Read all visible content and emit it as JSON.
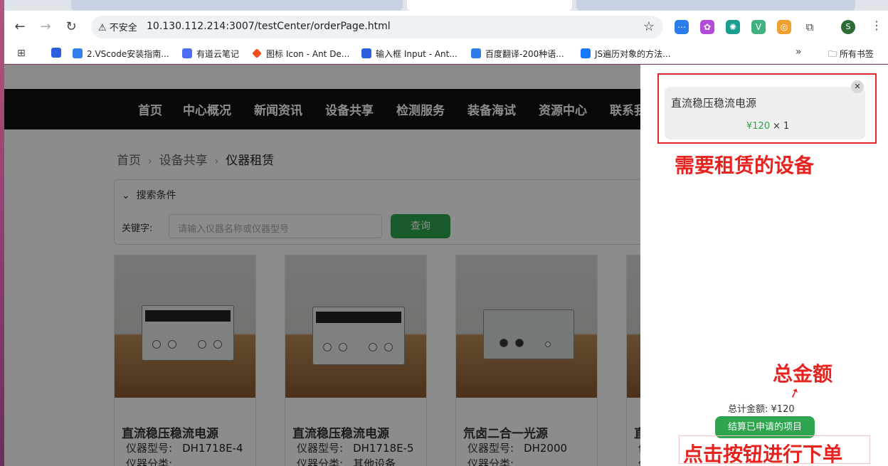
{
  "browser": {
    "security_label": "不安全",
    "url": "10.130.112.214:3007/testCenter/orderPage.html",
    "profile_initial": "S",
    "bookmarks": [
      {
        "label": "2.VScode安装指南..."
      },
      {
        "label": "有道云笔记"
      },
      {
        "label": "图标 Icon - Ant De..."
      },
      {
        "label": "输入框 Input - Ant..."
      },
      {
        "label": "百度翻译-200种语..."
      },
      {
        "label": "JS遍历对象的方法..."
      }
    ],
    "bookmarks_folder": "所有书签"
  },
  "nav": {
    "items": [
      "首页",
      "中心概况",
      "新闻资讯",
      "设备共享",
      "检测服务",
      "装备海试",
      "资源中心",
      "联系我们"
    ]
  },
  "breadcrumb": {
    "home": "首页",
    "section": "设备共享",
    "current": "仪器租赁"
  },
  "search": {
    "title": "搜索条件",
    "keyword_label": "关键字:",
    "placeholder": "请输入仪器名称或仪器型号",
    "button": "查询"
  },
  "cards": [
    {
      "name": "直流稳压稳流电源",
      "model_label": "仪器型号:",
      "model": "DH1718E-4",
      "category_label": "仪器分类:",
      "category": ""
    },
    {
      "name": "直流稳压稳流电源",
      "model_label": "仪器型号:",
      "model": "DH1718E-5",
      "category_label": "仪器分类:",
      "category": "其他设备"
    },
    {
      "name": "氘卤二合一光源",
      "model_label": "仪器型号:",
      "model": "DH2000",
      "category_label": "仪器分类:",
      "category": ""
    },
    {
      "name": "直",
      "model_label": "仪",
      "model": "",
      "category_label": "仪",
      "category": ""
    }
  ],
  "cart": {
    "item_name": "直流稳压稳流电源",
    "item_price": "¥120",
    "item_qty": "× 1",
    "total_label": "总计金额:",
    "total_value": "¥120",
    "submit": "结算已申请的项目"
  },
  "annotations": {
    "items": "需要租赁的设备",
    "total": "总金额",
    "action": "点击按钮进行下单"
  },
  "colors": {
    "accent": "#2ea44f",
    "annotation": "#e52420"
  }
}
